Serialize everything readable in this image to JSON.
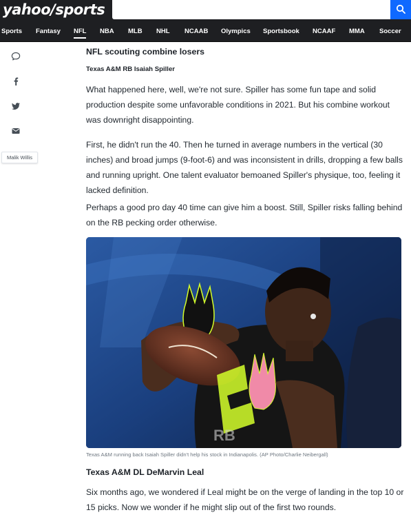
{
  "header": {
    "logo": "yahoo/sports",
    "search": {
      "placeholder": ""
    }
  },
  "nav": {
    "items": [
      {
        "label": "Sports"
      },
      {
        "label": "Fantasy"
      },
      {
        "label": "NFL",
        "active": true
      },
      {
        "label": "NBA"
      },
      {
        "label": "MLB"
      },
      {
        "label": "NHL"
      },
      {
        "label": "NCAAB"
      },
      {
        "label": "Olympics"
      },
      {
        "label": "Sportsbook"
      },
      {
        "label": "NCAAF"
      },
      {
        "label": "MMA"
      },
      {
        "label": "Soccer"
      }
    ]
  },
  "share_rail": {
    "icons": [
      "comment-icon",
      "facebook-icon",
      "twitter-icon",
      "email-icon"
    ],
    "author_tag": "Malik Willis"
  },
  "article": {
    "section_heading": "NFL scouting combine losers",
    "player_heading": "Texas A&M RB Isaiah Spiller",
    "paragraphs": [
      "What happened here, well, we're not sure. Spiller has some fun tape and solid production despite some unfavorable conditions in 2021. But his combine workout was downright disappointing.",
      "First, he didn't run the 40. Then he turned in average numbers in the vertical (30 inches) and broad jumps (9-foot-6) and was inconsistent in drills, dropping a few balls and running upright. One talent evaluator bemoaned Spiller's physique, too, feeling it lacked definition.",
      "Perhaps a good pro day 40 time can give him a boost. Still, Spiller risks falling behind on the RB pecking order otherwise."
    ],
    "image_caption": "Texas A&M running back Isaiah Spiller didn't help his stock in Indianapolis. (AP Photo/Charlie Neibergall)",
    "next_heading": "Texas A&M DL DeMarvin Leal",
    "next_paragraph": "Six months ago, we wondered if Leal might be on the verge of landing in the top 10 or 15 picks. Now we wonder if he might slip out of the first two rounds."
  },
  "colors": {
    "header_bg": "#1e1f22",
    "search_button": "#0f69ff",
    "text": "#232a31",
    "caption": "#6e7780"
  }
}
